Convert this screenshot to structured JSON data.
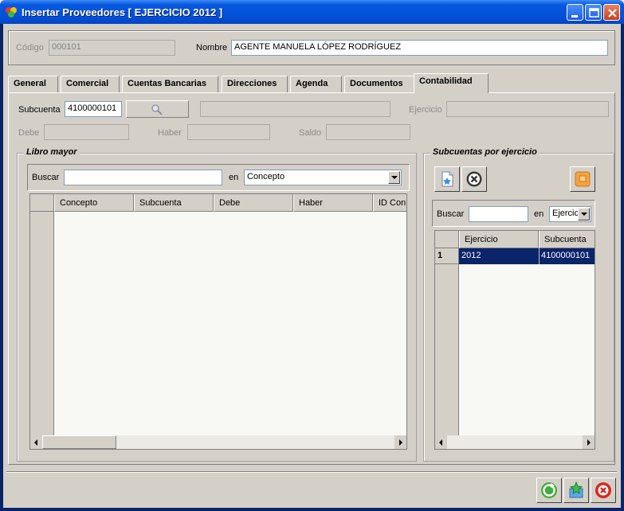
{
  "window": {
    "title": "Insertar Proveedores [ EJERCICIO 2012 ]"
  },
  "header": {
    "codigo_label": "Código",
    "codigo_value": "000101",
    "nombre_label": "Nombre",
    "nombre_value": "AGENTE MANUELA LÓPEZ RODRÍGUEZ"
  },
  "tabs": [
    {
      "label": "General",
      "active": false
    },
    {
      "label": "Comercial",
      "active": false
    },
    {
      "label": "Cuentas Bancarias",
      "active": false
    },
    {
      "label": "Direcciones",
      "active": false
    },
    {
      "label": "Agenda",
      "active": false
    },
    {
      "label": "Documentos",
      "active": false
    },
    {
      "label": "Contabilidad",
      "active": true
    }
  ],
  "contabilidad": {
    "subcuenta_label": "Subcuenta",
    "subcuenta_value": "4100000101",
    "subcuenta_desc": "",
    "ejercicio_label": "Ejercicio",
    "ejercicio_value": "",
    "debe_label": "Debe",
    "debe_value": "",
    "haber_label": "Haber",
    "haber_value": "",
    "saldo_label": "Saldo",
    "saldo_value": ""
  },
  "libro_mayor": {
    "title": "Libro mayor",
    "buscar_label": "Buscar",
    "buscar_value": "",
    "en_label": "en",
    "en_selected": "Concepto",
    "columns": [
      "Concepto",
      "Subcuenta",
      "Debe",
      "Haber",
      "ID Con"
    ],
    "rows": []
  },
  "subcuentas": {
    "title": "Subcuentas por ejercicio",
    "buscar_label": "Buscar",
    "buscar_value": "",
    "en_label": "en",
    "en_selected": "Ejercic",
    "columns": [
      "Ejercicio",
      "Subcuenta"
    ],
    "rows": [
      {
        "num": "1",
        "ejercicio": "2012",
        "subcuenta": "4100000101"
      }
    ]
  },
  "icons": {
    "title": "app-icon",
    "search": "magnifier-icon",
    "new_doc": "new-document-icon",
    "delete": "delete-icon",
    "export": "export-icon",
    "accept": "accept-icon",
    "save_new": "save-new-icon",
    "cancel": "cancel-icon"
  },
  "colors": {
    "selection": "#0a246a",
    "titlebar": "#0350d8"
  }
}
